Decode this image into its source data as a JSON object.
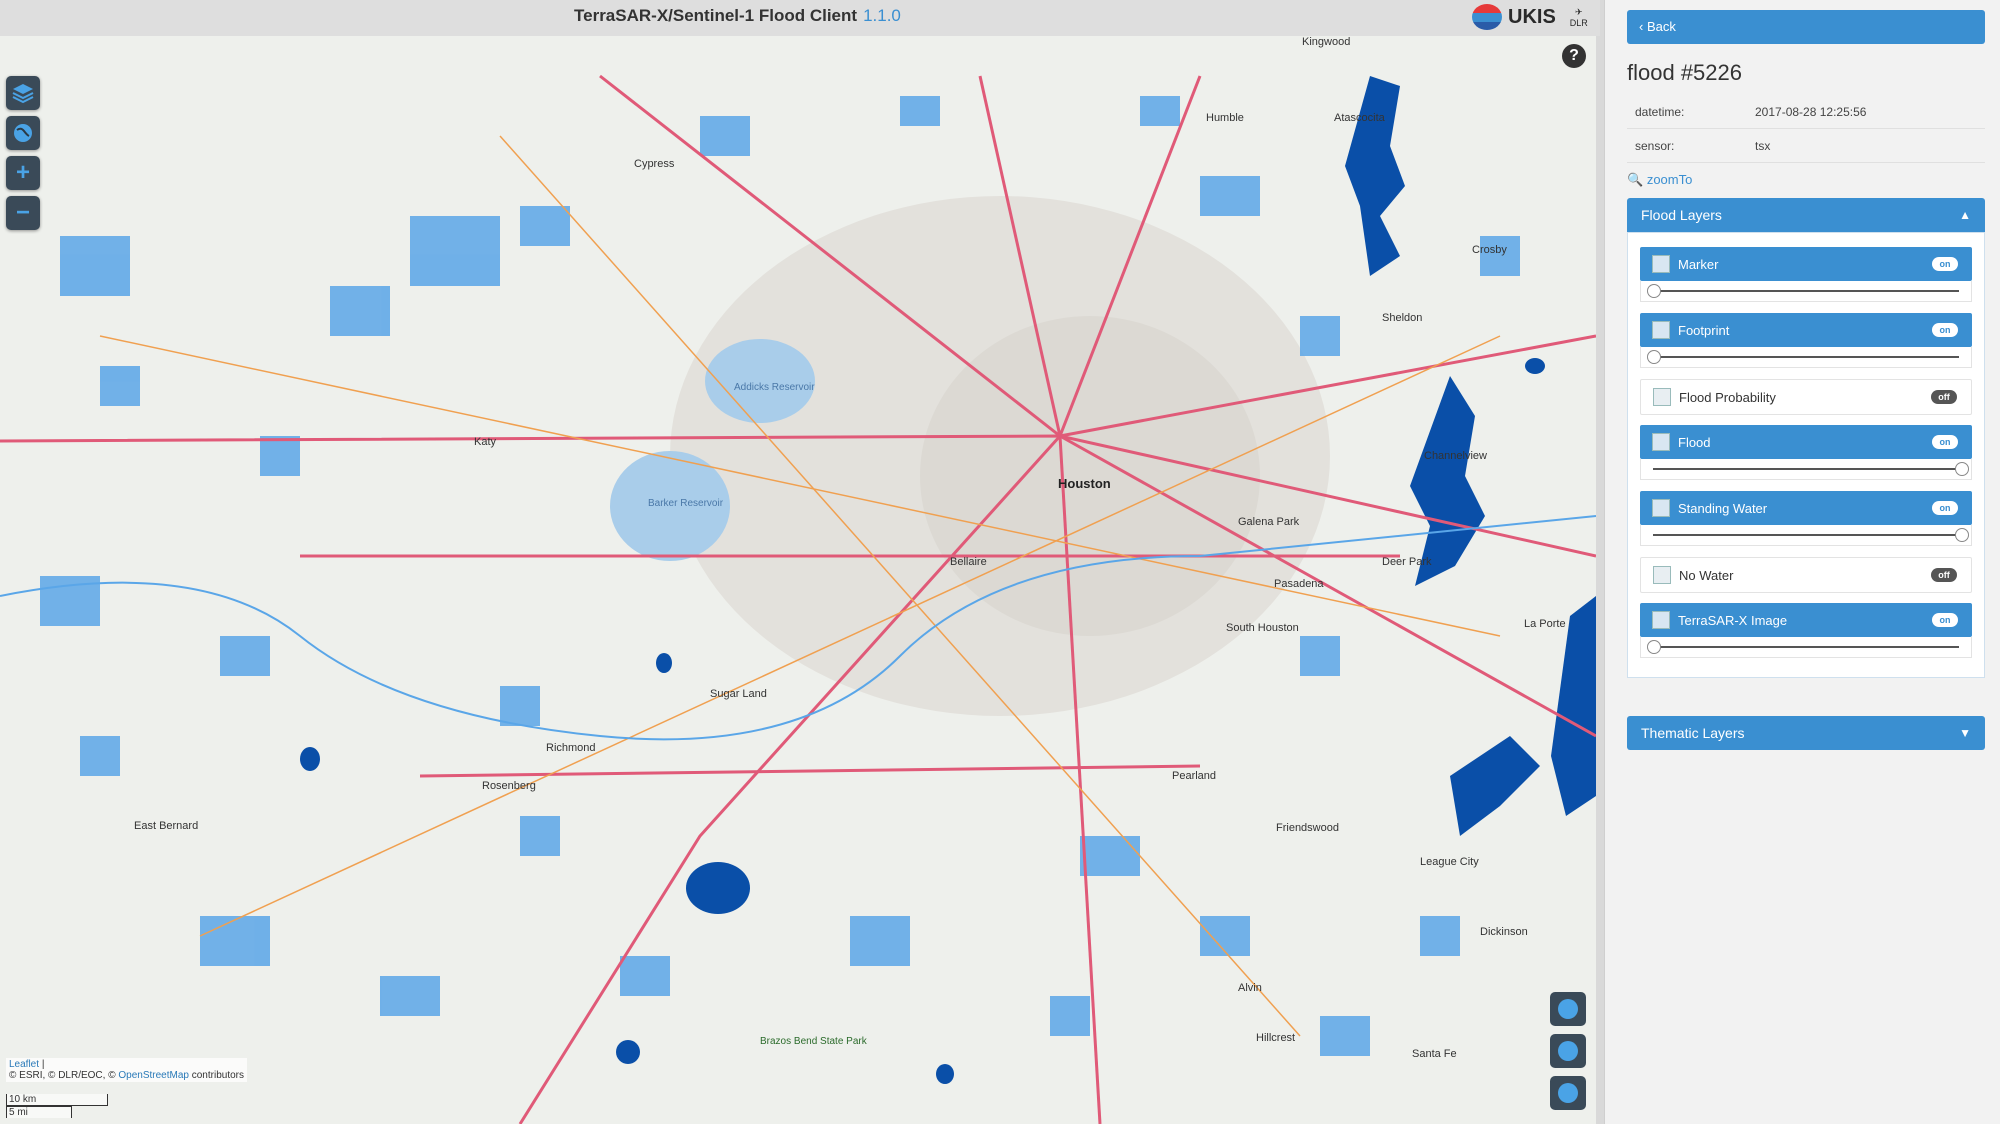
{
  "app": {
    "title": "TerraSAR-X/Sentinel-1 Flood Client",
    "version": "1.1.0",
    "logo_text": "UKIS",
    "logo_sub": "DLR"
  },
  "map": {
    "attribution": {
      "leaflet": "Leaflet",
      "separator": "|",
      "sources": "© ESRI, © DLR/EOC, ©",
      "osm": "OpenStreetMap",
      "suffix": "contributors"
    },
    "scale": {
      "km": "10 km",
      "mi": "5 mi"
    },
    "labels": {
      "houston": "Houston",
      "katy": "Katy",
      "cypress": "Cypress",
      "humble": "Humble",
      "kingwood": "Kingwood",
      "atascocita": "Atascocita",
      "crosby": "Crosby",
      "sheldon": "Sheldon",
      "channelview": "Channelview",
      "galena_park": "Galena Park",
      "deer_park": "Deer Park",
      "pasadena": "Pasadena",
      "south_houston": "South Houston",
      "la_porte": "La Porte",
      "bellaire": "Bellaire",
      "sugar_land": "Sugar Land",
      "richmond": "Richmond",
      "rosenberg": "Rosenberg",
      "east_bernard": "East Bernard",
      "pearland": "Pearland",
      "friendswood": "Friendswood",
      "league_city": "League City",
      "dickinson": "Dickinson",
      "alvin": "Alvin",
      "hillcrest": "Hillcrest",
      "santa_fe": "Santa Fe",
      "addicks": "Addicks Reservoir",
      "barker": "Barker Reservoir",
      "brazos_bend": "Brazos Bend State Park"
    }
  },
  "sidebar": {
    "back_label": "Back",
    "flood_title": "flood #5226",
    "info": {
      "datetime_label": "datetime:",
      "datetime_value": "2017-08-28 12:25:56",
      "sensor_label": "sensor:",
      "sensor_value": "tsx"
    },
    "zoomto_label": "zoomTo",
    "flood_layers": {
      "title": "Flood Layers",
      "layers": [
        {
          "label": "Marker",
          "state": "on",
          "opacity": 0.0
        },
        {
          "label": "Footprint",
          "state": "on",
          "opacity": 0.0
        },
        {
          "label": "Flood Probability",
          "state": "off"
        },
        {
          "label": "Flood",
          "state": "on",
          "opacity": 1.0
        },
        {
          "label": "Standing Water",
          "state": "on",
          "opacity": 1.0
        },
        {
          "label": "No Water",
          "state": "off"
        },
        {
          "label": "TerraSAR-X Image",
          "state": "on",
          "opacity": 0.0
        }
      ]
    },
    "thematic_layers": {
      "title": "Thematic Layers"
    }
  },
  "colors": {
    "accent": "#3a8fd1",
    "flood": "#0a4fa8",
    "water": "#5aa6e8",
    "road": "#e05a78"
  }
}
